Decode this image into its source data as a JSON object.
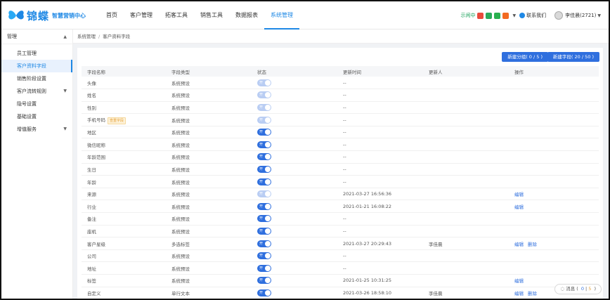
{
  "brand": {
    "name": "锦蝶",
    "subtitle": "智慧营销中心"
  },
  "nav": [
    "首页",
    "客户管理",
    "拓客工具",
    "销售工具",
    "数据报表",
    "系统管理"
  ],
  "topright": {
    "trial": "示闲中",
    "contact": "联系我们",
    "user": "李佳晨(2721)"
  },
  "sidebar": {
    "header": "管理",
    "items": [
      "员工管理",
      "客户资料字段",
      "销售阶段设置",
      "客户流转规则",
      "隐号设置",
      "基础设置",
      "增值服务"
    ]
  },
  "breadcrumb": [
    "系统管理",
    "客户资料字段"
  ],
  "buttons": {
    "new_group": "新建分组( 0 / 5 )",
    "new_field": "新建字段( 20 / 50 )"
  },
  "table": {
    "headers": [
      "字段名称",
      "字段类型",
      "状态",
      "更新时间",
      "更新人",
      "操作"
    ],
    "switch_label": "开",
    "rows": [
      {
        "name": "头像",
        "type": "系统预设",
        "on": false,
        "time": "--",
        "user": "",
        "ops": []
      },
      {
        "name": "姓名",
        "type": "系统预设",
        "on": false,
        "time": "--",
        "user": "",
        "ops": []
      },
      {
        "name": "性别",
        "type": "系统预设",
        "on": false,
        "time": "--",
        "user": "",
        "ops": []
      },
      {
        "name": "手机号码",
        "tag": "查重字段",
        "type": "系统预设",
        "on": false,
        "time": "--",
        "user": "",
        "ops": []
      },
      {
        "name": "地区",
        "type": "系统预设",
        "on": true,
        "time": "--",
        "user": "",
        "ops": []
      },
      {
        "name": "微信昵称",
        "type": "系统预设",
        "on": true,
        "time": "--",
        "user": "",
        "ops": []
      },
      {
        "name": "年龄范围",
        "type": "系统预设",
        "on": true,
        "time": "--",
        "user": "",
        "ops": []
      },
      {
        "name": "生日",
        "type": "系统预设",
        "on": true,
        "time": "--",
        "user": "",
        "ops": []
      },
      {
        "name": "年龄",
        "type": "系统预设",
        "on": true,
        "time": "--",
        "user": "",
        "ops": []
      },
      {
        "name": "来源",
        "type": "系统预设",
        "on": false,
        "time": "2021-03-27 16:56:36",
        "user": "",
        "ops": [
          "编辑"
        ]
      },
      {
        "name": "行业",
        "type": "系统预设",
        "on": true,
        "time": "2021-01-21 16:08:22",
        "user": "",
        "ops": [
          "编辑"
        ]
      },
      {
        "name": "备注",
        "type": "系统预设",
        "on": true,
        "time": "--",
        "user": "",
        "ops": []
      },
      {
        "name": "座机",
        "type": "系统预设",
        "on": true,
        "time": "--",
        "user": "",
        "ops": []
      },
      {
        "name": "客户星级",
        "type": "多选标签",
        "on": true,
        "time": "2021-03-27 20:29:43",
        "user": "李佳晨",
        "ops": [
          "编辑",
          "删除"
        ]
      },
      {
        "name": "公司",
        "type": "系统预设",
        "on": true,
        "time": "--",
        "user": "",
        "ops": []
      },
      {
        "name": "地址",
        "type": "系统预设",
        "on": true,
        "time": "--",
        "user": "",
        "ops": []
      },
      {
        "name": "标签",
        "type": "系统预设",
        "on": true,
        "time": "2021-01-25 10:31:25",
        "user": "",
        "ops": [
          "编辑"
        ]
      },
      {
        "name": "自定义",
        "type": "单行文本",
        "on": true,
        "time": "2021-03-26 18:58:10",
        "user": "李佳晨",
        "ops": [
          "编辑",
          "删除"
        ]
      }
    ]
  },
  "message": {
    "label": "消息",
    "count_a": "0",
    "count_b": "5"
  },
  "colors": {
    "primary": "#2f6fde",
    "brand": "#1e88e5"
  },
  "icons": [
    "butterfly-logo-icon",
    "shop-icon",
    "caret-down-icon",
    "contact-icon",
    "avatar-icon",
    "chat-icon"
  ]
}
